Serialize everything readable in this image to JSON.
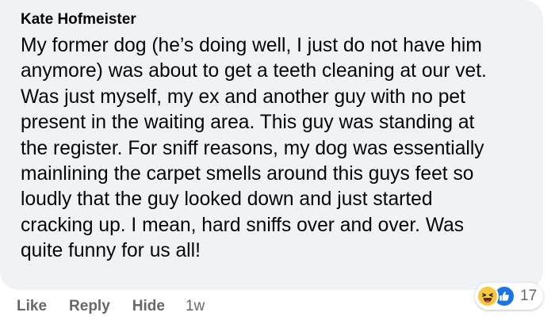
{
  "comment": {
    "author": "Kate Hofmeister",
    "lines": [
      "My former dog (he’s doing well, I just do not have him",
      "anymore) was about to get a teeth cleaning at our vet.",
      "Was just myself, my ex and another guy with no pet",
      "present in the waiting area. This guy was standing at",
      "the register. For sniff reasons, my dog was essentially",
      "mainlining the carpet smells around this guys feet so",
      "loudly that the guy looked down and just started",
      "cracking up. I mean, hard sniffs over and over. Was",
      "quite funny for us all!"
    ]
  },
  "actions": {
    "like": "Like",
    "reply": "Reply",
    "hide": "Hide",
    "timestamp": "1w"
  },
  "reactions": {
    "icons": [
      "haha-icon",
      "like-icon"
    ],
    "count": "17",
    "colors": {
      "haha": "#f7c83e",
      "like": "#1b74e4"
    }
  },
  "colors": {
    "bubble": "#f0f2f5",
    "text": "#050505",
    "secondary": "#65676b"
  }
}
